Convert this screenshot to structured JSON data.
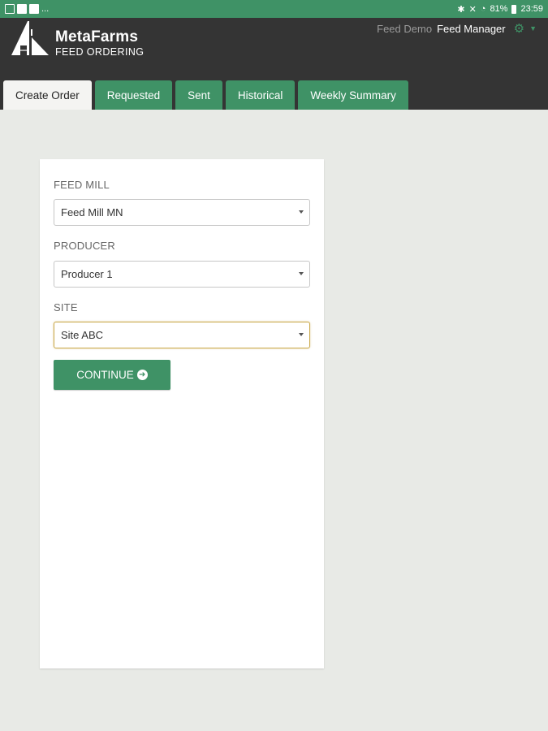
{
  "status_bar": {
    "left_dots": "...",
    "battery": "81%",
    "time": "23:59"
  },
  "header": {
    "brand_name": "MetaFarms",
    "brand_sub": "FEED ORDERING",
    "user_org": "Feed Demo",
    "user_role": "Feed Manager"
  },
  "tabs": [
    {
      "label": "Create Order",
      "active": true
    },
    {
      "label": "Requested"
    },
    {
      "label": "Sent"
    },
    {
      "label": "Historical"
    },
    {
      "label": "Weekly Summary"
    }
  ],
  "form": {
    "feed_mill_label": "FEED MILL",
    "feed_mill_value": "Feed Mill MN",
    "producer_label": "PRODUCER",
    "producer_value": "Producer 1",
    "site_label": "SITE",
    "site_value": "Site ABC",
    "continue_label": "CONTINUE"
  },
  "colors": {
    "accent": "#3f9266",
    "header_bg": "#343434",
    "page_bg": "#e8eae6",
    "focus_border": "#c9a84a"
  }
}
